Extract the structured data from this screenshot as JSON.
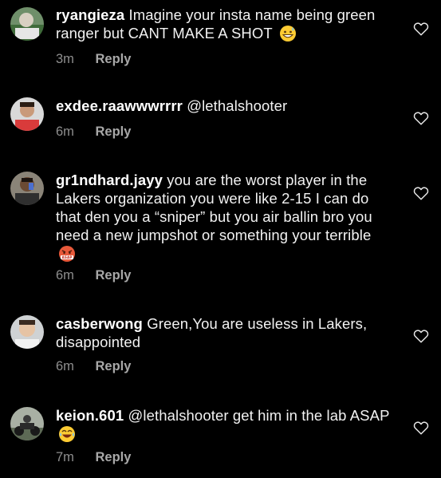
{
  "comments": [
    {
      "username": "ryangieza",
      "text": "Imagine your insta name being green ranger but CANT MAKE A SHOT",
      "emoji": "grinning-sweat-emoji",
      "time": "3m",
      "reply_label": "Reply",
      "like_icon": "heart-outline-icon"
    },
    {
      "username": "exdee.raawwwrrrr",
      "text": "@lethalshooter",
      "time": "6m",
      "reply_label": "Reply",
      "like_icon": "heart-outline-icon"
    },
    {
      "username": "gr1ndhard.jayy",
      "text": "you are the worst player in the Lakers organization you were like 2-15 I can do that den you a “sniper” but you air ballin bro you need a new jumpshot or something your terrible",
      "emoji": "angry-asap-emoji",
      "time": "6m",
      "reply_label": "Reply",
      "like_icon": "heart-outline-icon"
    },
    {
      "username": "casberwong",
      "text": "Green,You are useless in Lakers, disappointed",
      "time": "6m",
      "reply_label": "Reply",
      "like_icon": "heart-outline-icon"
    },
    {
      "username": "keion.601",
      "text": "@lethalshooter get him in the lab ASAP",
      "emoji": "laughing-emoji",
      "time": "7m",
      "reply_label": "Reply",
      "like_icon": "heart-outline-icon"
    }
  ],
  "colors": {
    "background": "#000000",
    "text": "#f2f2f2",
    "meta": "#8e8e8e"
  }
}
